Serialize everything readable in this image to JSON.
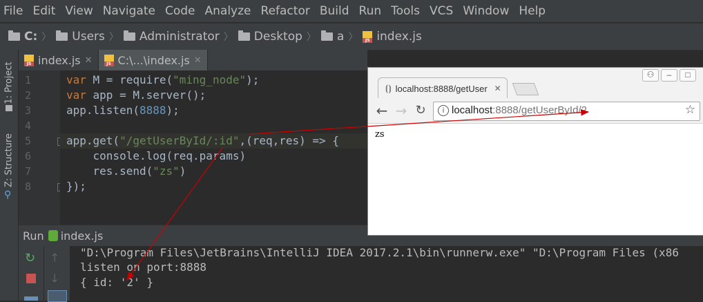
{
  "menu": [
    "File",
    "Edit",
    "View",
    "Navigate",
    "Code",
    "Analyze",
    "Refactor",
    "Build",
    "Run",
    "Tools",
    "VCS",
    "Window",
    "Help"
  ],
  "breadcrumb": [
    "C:",
    "Users",
    "Administrator",
    "Desktop",
    "a",
    "index.js"
  ],
  "side_tabs": {
    "project": "1: Project",
    "structure": "Z: Structure"
  },
  "tabs": [
    {
      "label": "index.js",
      "active": false
    },
    {
      "label": "C:\\...\\index.js",
      "active": true
    }
  ],
  "code_lines": [
    {
      "n": "1",
      "parts": [
        [
          "kw",
          "var"
        ],
        [
          "pl",
          " M = require("
        ],
        [
          "str",
          "\"ming_node\""
        ],
        [
          "pl",
          ");"
        ]
      ]
    },
    {
      "n": "2",
      "parts": [
        [
          "kw",
          "var"
        ],
        [
          "pl",
          " app = M.server();"
        ]
      ]
    },
    {
      "n": "3",
      "parts": [
        [
          "pl",
          "app.listen("
        ],
        [
          "num",
          "8888"
        ],
        [
          "pl",
          ");"
        ]
      ]
    },
    {
      "n": "4",
      "parts": []
    },
    {
      "n": "5",
      "parts": [
        [
          "pl",
          "app.get("
        ],
        [
          "str",
          "\"/getUserById/:id\""
        ],
        [
          "pl",
          ",(req,res) => {"
        ]
      ]
    },
    {
      "n": "6",
      "parts": [
        [
          "pl",
          "    console.log(req.params)"
        ]
      ]
    },
    {
      "n": "7",
      "parts": [
        [
          "pl",
          "    res.send("
        ],
        [
          "str",
          "\"zs\""
        ],
        [
          "pl",
          ")"
        ]
      ]
    },
    {
      "n": "8",
      "parts": [
        [
          "pl",
          "});"
        ]
      ]
    }
  ],
  "run": {
    "label": "Run",
    "file": "index.js",
    "console": [
      "\"D:\\Program Files\\JetBrains\\IntelliJ IDEA 2017.2.1\\bin\\runnerw.exe\" \"D:\\Program Files (x86",
      "listen on port:8888",
      "{ id: '2' }"
    ]
  },
  "browser": {
    "tab_title": "localhost:8888/getUser",
    "url_host": "localhost",
    "url_rest": ":8888/getUserById/2",
    "body": "zs"
  },
  "colors": {
    "arrow": "#cc0000"
  }
}
